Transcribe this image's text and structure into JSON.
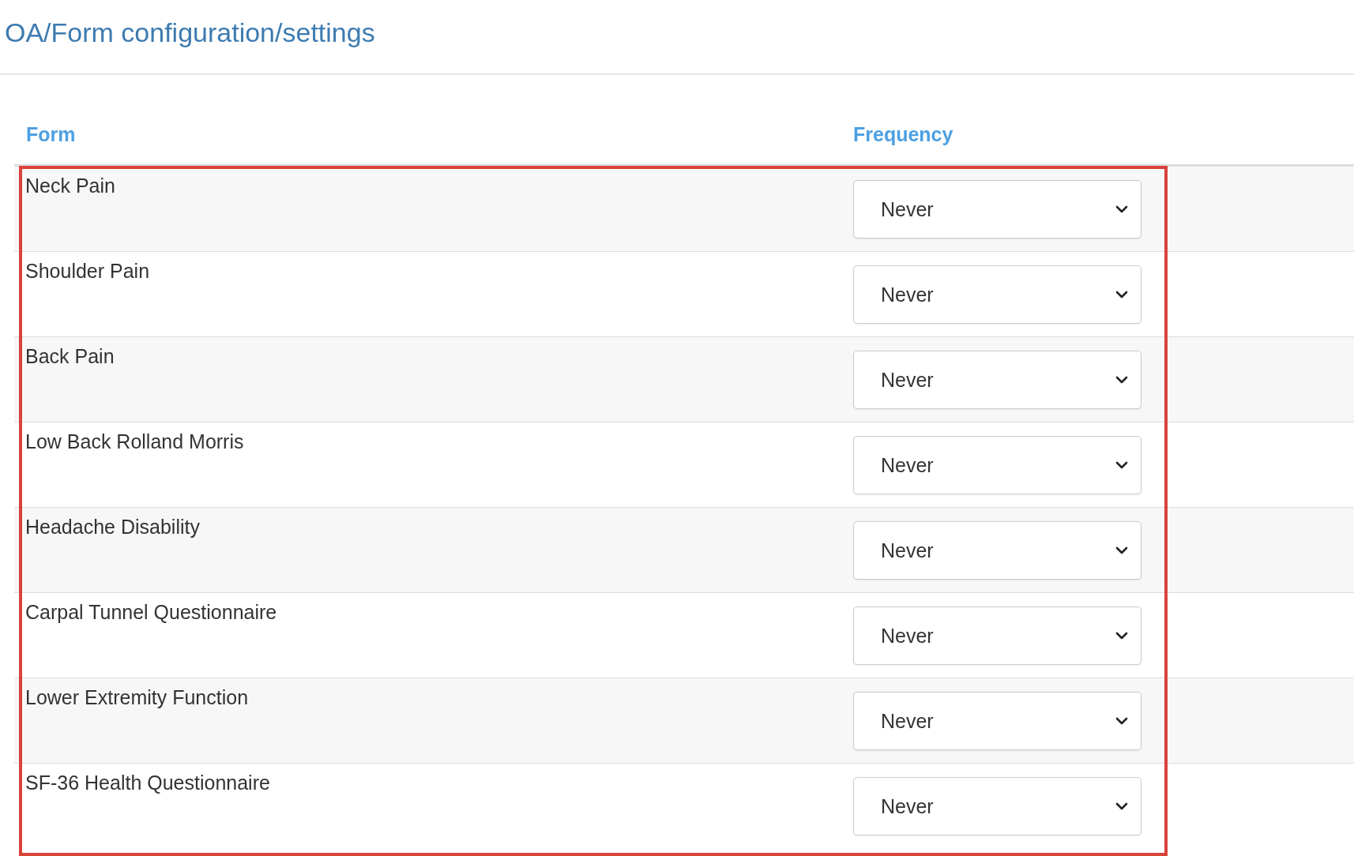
{
  "page": {
    "title": "OA/Form configuration/settings"
  },
  "table": {
    "columns": [
      "Form",
      "Frequency"
    ],
    "rows": [
      {
        "form": "Neck Pain",
        "frequency": "Never"
      },
      {
        "form": "Shoulder Pain",
        "frequency": "Never"
      },
      {
        "form": "Back Pain",
        "frequency": "Never"
      },
      {
        "form": "Low Back Rolland Morris",
        "frequency": "Never"
      },
      {
        "form": "Headache Disability",
        "frequency": "Never"
      },
      {
        "form": "Carpal Tunnel Questionnaire",
        "frequency": "Never"
      },
      {
        "form": "Lower Extremity Function",
        "frequency": "Never"
      },
      {
        "form": "SF-36 Health Questionnaire",
        "frequency": "Never"
      }
    ]
  }
}
